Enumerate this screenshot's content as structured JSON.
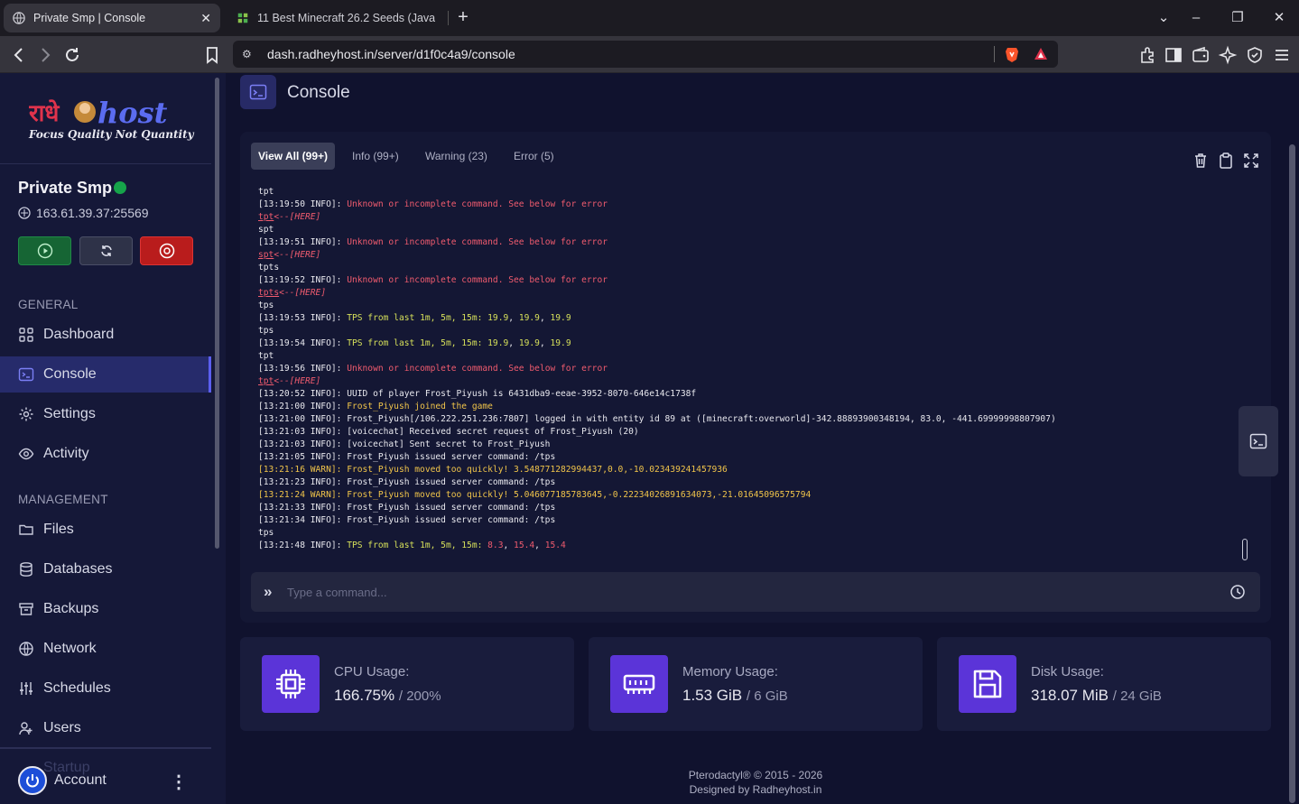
{
  "browser": {
    "tabs": [
      {
        "title": "Private Smp | Console",
        "close": "✕"
      },
      {
        "title": "11 Best Minecraft 26.2 Seeds (Java &"
      }
    ],
    "url": "dash.radheyhost.in/server/d1f0c4a9/console"
  },
  "sidebar": {
    "logo_text": "राधे host",
    "logo_tagline": "Focus Quality Not Quantity",
    "server_name": "Private Smp",
    "server_ip": "163.61.39.37:25569",
    "general_label": "GENERAL",
    "general_items": [
      {
        "label": "Dashboard",
        "icon": "grid-icon"
      },
      {
        "label": "Console",
        "icon": "terminal-icon",
        "active": true
      },
      {
        "label": "Settings",
        "icon": "gear-icon"
      },
      {
        "label": "Activity",
        "icon": "eye-icon"
      }
    ],
    "management_label": "MANAGEMENT",
    "management_items": [
      {
        "label": "Files",
        "icon": "folder-icon"
      },
      {
        "label": "Databases",
        "icon": "database-icon"
      },
      {
        "label": "Backups",
        "icon": "archive-icon"
      },
      {
        "label": "Network",
        "icon": "network-icon"
      },
      {
        "label": "Schedules",
        "icon": "sliders-icon"
      },
      {
        "label": "Users",
        "icon": "users-icon"
      }
    ],
    "hidden_item": "Startup",
    "account_label": "Account",
    "colors": {
      "online": "#16a34a",
      "start": "#166534",
      "restart": "#2e3248",
      "stop": "#b91c1c"
    }
  },
  "page": {
    "title": "Console"
  },
  "console": {
    "filters": [
      "View All (99+)",
      "Info (99+)",
      "Warning (23)",
      "Error (5)"
    ],
    "command_placeholder": "Type a command...",
    "lines": [
      [
        [
          "tpt",
          ""
        ]
      ],
      [
        [
          "[13:19:50 INFO]: ",
          ""
        ],
        [
          "Unknown or incomplete command. See below for error",
          "red"
        ]
      ],
      [
        [
          "tpt",
          "redu"
        ],
        [
          "<--[HERE]",
          "redi"
        ]
      ],
      [
        [
          "spt",
          ""
        ]
      ],
      [
        [
          "[13:19:51 INFO]: ",
          ""
        ],
        [
          "Unknown or incomplete command. See below for error",
          "red"
        ]
      ],
      [
        [
          "spt",
          "redu"
        ],
        [
          "<--[HERE]",
          "redi"
        ]
      ],
      [
        [
          "tpts",
          ""
        ]
      ],
      [
        [
          "[13:19:52 INFO]: ",
          ""
        ],
        [
          "Unknown or incomplete command. See below for error",
          "red"
        ]
      ],
      [
        [
          "tpts",
          "redu"
        ],
        [
          "<--[HERE]",
          "redi"
        ]
      ],
      [
        [
          "tps",
          ""
        ]
      ],
      [
        [
          "[13:19:53 INFO]: ",
          ""
        ],
        [
          "TPS from last 1m, 5m, 15m: ",
          "grn"
        ],
        [
          "19.9",
          "grn"
        ],
        [
          ", ",
          ""
        ],
        [
          "19.9",
          "grn"
        ],
        [
          ", ",
          ""
        ],
        [
          "19.9",
          "grn"
        ]
      ],
      [
        [
          "tps",
          ""
        ]
      ],
      [
        [
          "[13:19:54 INFO]: ",
          ""
        ],
        [
          "TPS from last 1m, 5m, 15m: ",
          "grn"
        ],
        [
          "19.9",
          "grn"
        ],
        [
          ", ",
          ""
        ],
        [
          "19.9",
          "grn"
        ],
        [
          ", ",
          ""
        ],
        [
          "19.9",
          "grn"
        ]
      ],
      [
        [
          "tpt",
          ""
        ]
      ],
      [
        [
          "[13:19:56 INFO]: ",
          ""
        ],
        [
          "Unknown or incomplete command. See below for error",
          "red"
        ]
      ],
      [
        [
          "tpt",
          "redu"
        ],
        [
          "<--[HERE]",
          "redi"
        ]
      ],
      [
        [
          "[13:20:52 INFO]: UUID of player Frost_Piyush is 6431dba9-eeae-3952-8070-646e14c1738f",
          ""
        ]
      ],
      [
        [
          "[13:21:00 INFO]: ",
          ""
        ],
        [
          "Frost_Piyush joined the game",
          "yel"
        ]
      ],
      [
        [
          "[13:21:00 INFO]: Frost_Piyush[/106.222.251.236:7807] logged in with entity id 89 at ([minecraft:overworld]-342.88893900348194, 83.0, -441.69999998807907)",
          ""
        ]
      ],
      [
        [
          "[13:21:03 INFO]: [voicechat] Received secret request of Frost_Piyush (20)",
          ""
        ]
      ],
      [
        [
          "[13:21:03 INFO]: [voicechat] Sent secret to Frost_Piyush",
          ""
        ]
      ],
      [
        [
          "[13:21:05 INFO]: Frost_Piyush issued server command: /tps",
          ""
        ]
      ],
      [
        [
          "[13:21:16 WARN]: Frost_Piyush moved too quickly! 3.548771282994437,0.0,-10.023439241457936",
          "yel"
        ]
      ],
      [
        [
          "[13:21:23 INFO]: Frost_Piyush issued server command: /tps",
          ""
        ]
      ],
      [
        [
          "[13:21:24 WARN]: Frost_Piyush moved too quickly! 5.046077185783645,-0.22234026891634073,-21.01645096575794",
          "yel"
        ]
      ],
      [
        [
          "[13:21:33 INFO]: Frost_Piyush issued server command: /tps",
          ""
        ]
      ],
      [
        [
          "[13:21:34 INFO]: Frost_Piyush issued server command: /tps",
          ""
        ]
      ],
      [
        [
          "tps",
          ""
        ]
      ],
      [
        [
          "[13:21:48 INFO]: ",
          ""
        ],
        [
          "TPS from last 1m, 5m, 15m: ",
          "grn"
        ],
        [
          "8.3",
          "red"
        ],
        [
          ", ",
          ""
        ],
        [
          "15.4",
          "red"
        ],
        [
          ", ",
          ""
        ],
        [
          "15.4",
          "red"
        ]
      ]
    ]
  },
  "stats": [
    {
      "label": "CPU Usage:",
      "value": "166.75%",
      "limit": "/ 200%",
      "icon": "cpu-icon"
    },
    {
      "label": "Memory Usage:",
      "value": "1.53 GiB",
      "limit": "/ 6 GiB",
      "icon": "memory-icon"
    },
    {
      "label": "Disk Usage:",
      "value": "318.07 MiB",
      "limit": "/ 24 GiB",
      "icon": "save-icon"
    }
  ],
  "footer": {
    "line1": "Pterodactyl® © 2015 - 2026",
    "line2": "Designed by Radheyhost.in"
  }
}
